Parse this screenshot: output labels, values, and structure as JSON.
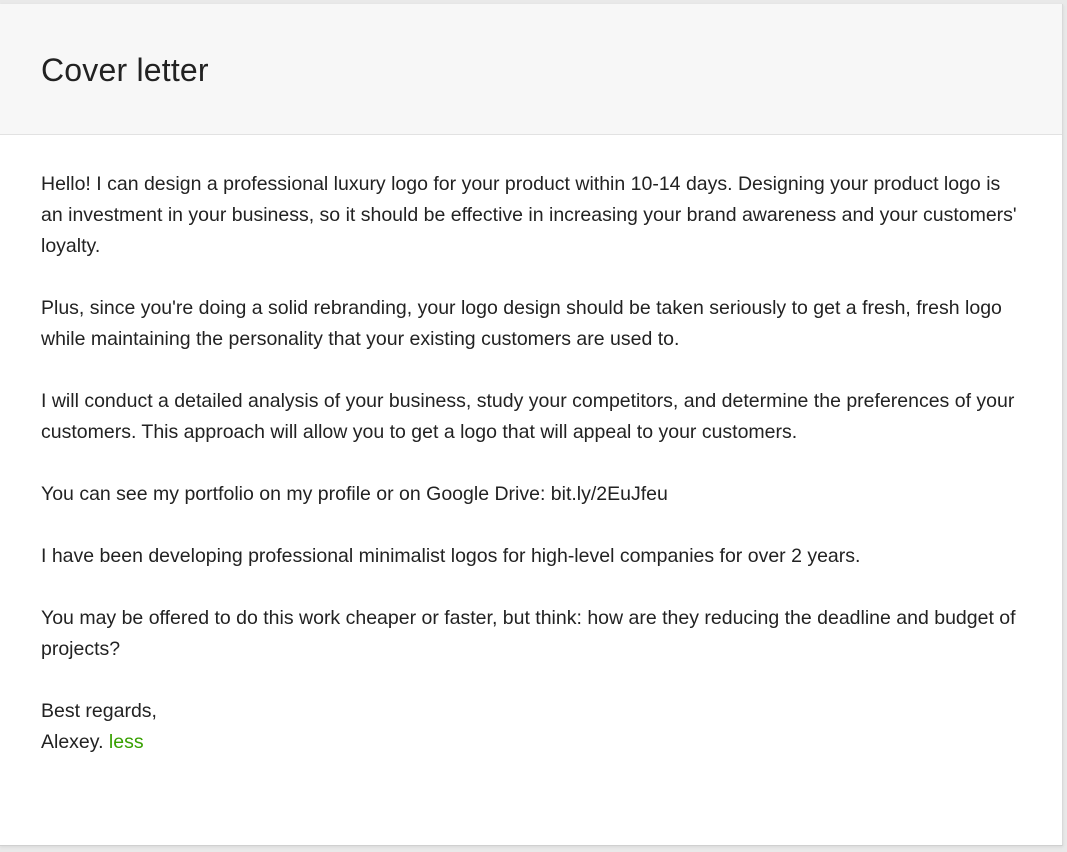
{
  "header": {
    "title": "Cover letter"
  },
  "letter": {
    "paragraphs": [
      "Hello! I can design a professional luxury logo for your product within 10-14 days. Designing your product logo is an investment in your business, so it should be effective in increasing your brand awareness and your customers' loyalty.",
      "Plus, since you're doing a solid rebranding, your logo design should be taken seriously to get a fresh, fresh logo while maintaining the personality that your existing customers are used to.",
      "I will conduct a detailed analysis of your business, study your competitors, and determine the preferences of your customers. This approach will allow you to get a logo that will appeal to your customers.",
      "You can see my portfolio on my profile or on Google Drive: bit.ly/2EuJfeu",
      "I have been developing professional minimalist logos for high-level companies for over 2 years.",
      "You may be offered to do this work cheaper or faster, but think: how are they reducing the deadline and budget of projects?"
    ],
    "closing": "Best regards,",
    "signature": "Alexey.",
    "less_link": "less"
  },
  "colors": {
    "link": "#37a000",
    "text": "#222222",
    "header_bg": "#f7f7f7"
  }
}
